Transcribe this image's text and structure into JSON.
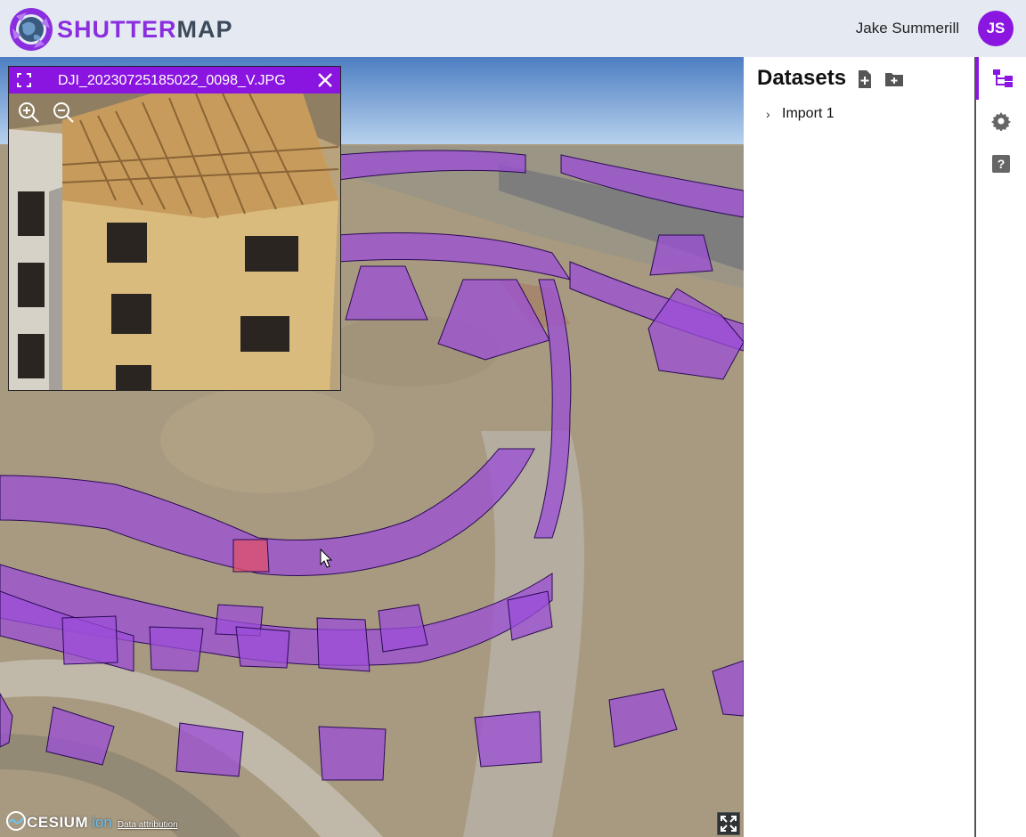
{
  "app": {
    "brand_part1": "SHUTTER",
    "brand_part2": "MAP",
    "accent": "#8a14e0"
  },
  "user": {
    "name": "Jake Summerill",
    "initials": "JS"
  },
  "image_viewer": {
    "filename": "DJI_20230725185022_0098_V.JPG",
    "icons": [
      "expand-icon",
      "close-icon",
      "zoom-in-icon",
      "zoom-out-icon"
    ]
  },
  "map": {
    "credit_brand": "CESIUM",
    "credit_product": "ion",
    "attribution_link": "Data attribution",
    "icons": [
      "fullscreen-icon"
    ]
  },
  "datasets": {
    "title": "Datasets",
    "items": [
      {
        "label": "Import 1",
        "expanded": false
      }
    ],
    "icons": [
      "add-file-icon",
      "add-folder-icon"
    ]
  },
  "rail": {
    "items": [
      "tree-icon",
      "gear-icon",
      "help-icon"
    ],
    "active": "tree-icon"
  }
}
